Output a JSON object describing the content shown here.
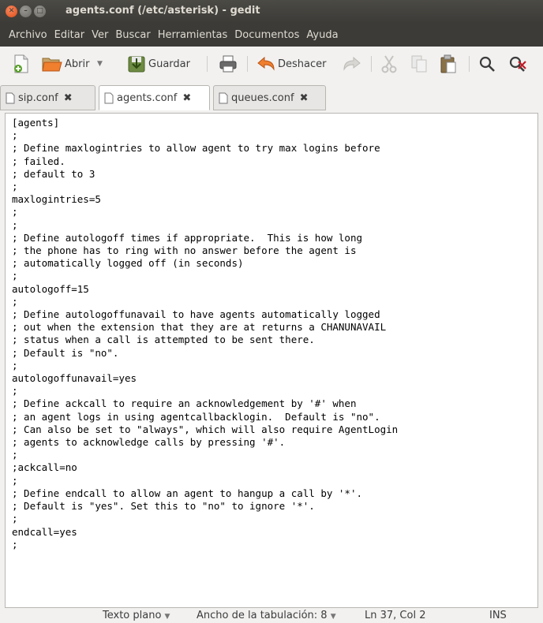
{
  "window": {
    "title": "agents.conf (/etc/asterisk) - gedit"
  },
  "menu": [
    "Archivo",
    "Editar",
    "Ver",
    "Buscar",
    "Herramientas",
    "Documentos",
    "Ayuda"
  ],
  "toolbar": {
    "open_label": "Abrir",
    "save_label": "Guardar",
    "undo_label": "Deshacer"
  },
  "tabs": [
    {
      "label": "sip.conf",
      "active": false
    },
    {
      "label": "agents.conf",
      "active": true
    },
    {
      "label": "queues.conf",
      "active": false
    }
  ],
  "editor": {
    "lines": [
      "[agents]",
      ";",
      "; Define maxlogintries to allow agent to try max logins before",
      "; failed.",
      "; default to 3",
      ";",
      "maxlogintries=5",
      ";",
      ";",
      "; Define autologoff times if appropriate.  This is how long",
      "; the phone has to ring with no answer before the agent is",
      "; automatically logged off (in seconds)",
      ";",
      "autologoff=15",
      ";",
      "; Define autologoffunavail to have agents automatically logged",
      "; out when the extension that they are at returns a CHANUNAVAIL",
      "; status when a call is attempted to be sent there.",
      "; Default is \"no\".",
      ";",
      "autologoffunavail=yes",
      ";",
      "; Define ackcall to require an acknowledgement by '#' when",
      "; an agent logs in using agentcallbacklogin.  Default is \"no\".",
      "; Can also be set to \"always\", which will also require AgentLogin",
      "; agents to acknowledge calls by pressing '#'.",
      ";",
      ";ackcall=no",
      ";",
      "; Define endcall to allow an agent to hangup a call by '*'.",
      "; Default is \"yes\". Set this to \"no\" to ignore '*'.",
      ";",
      "endcall=yes",
      ";"
    ]
  },
  "statusbar": {
    "language": "Texto plano",
    "tab_width": "Ancho de la tabulación: 8",
    "position": "Ln 37, Col 2",
    "mode": "INS"
  }
}
